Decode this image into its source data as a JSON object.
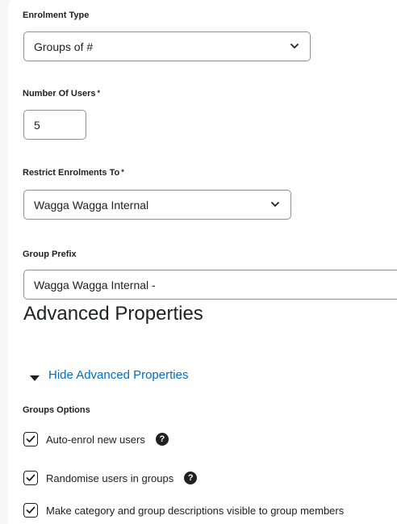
{
  "enrolment_type": {
    "label": "Enrolment Type",
    "value": "Groups of #"
  },
  "number_of_users": {
    "label": "Number Of Users",
    "required_mark": "*",
    "value": "5"
  },
  "restrict_enrolments": {
    "label": "Restrict Enrolments To",
    "required_mark": "*",
    "value": "Wagga Wagga Internal"
  },
  "group_prefix": {
    "label": "Group Prefix",
    "value": "Wagga Wagga Internal -"
  },
  "advanced": {
    "heading": "Advanced Properties",
    "toggle_label": "Hide Advanced Properties"
  },
  "groups_options": {
    "label": "Groups Options",
    "items": [
      {
        "label": "Auto-enrol new users",
        "checked": true,
        "help_icon": "question-circle-icon"
      },
      {
        "label": "Randomise users in groups",
        "checked": true,
        "help_icon": "question-circle-icon"
      },
      {
        "label": "Make category and group descriptions visible to group members",
        "checked": true
      }
    ]
  },
  "colors": {
    "link": "#006fbf",
    "text": "#202122",
    "border": "#8f9196"
  }
}
